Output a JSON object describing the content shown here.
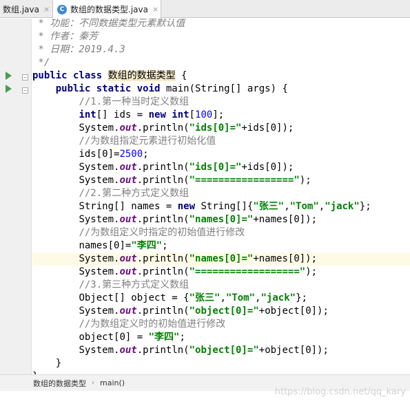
{
  "tabs": [
    {
      "label": "数组.java",
      "close": "×"
    },
    {
      "label": "数组的数据类型.java",
      "close": "×",
      "icon": "C"
    }
  ],
  "code": {
    "l01_comment": " * 功能：不同数据类型元素默认值",
    "l02_comment": " * 作者：秦芳",
    "l03_a": " * 日期：",
    "l03_b": "2019.4.3",
    "l04_comment": " */",
    "l05_kw": "public class",
    "l05_cls": "数组的数据类型",
    "l05_tail": " {",
    "l06_kw": "public static void",
    "l06_tail": " main(String[] args) {",
    "l07_comment": "//1.第一种当时定义数组",
    "l08_a": "int",
    "l08_b": "[] ids = ",
    "l08_c": "new int",
    "l08_d": "[",
    "l08_e": "100",
    "l08_f": "];",
    "sysout_a": "System.",
    "sysout_b": "out",
    "sysout_c": ".println(",
    "l09_str": "\"ids[0]=\"",
    "l09_tail": "+ids[0]);",
    "l10_comment": "//为数组指定元素进行初始化值",
    "l11_a": "ids[0]=",
    "l11_b": "2500",
    "l11_c": ";",
    "l12_str": "\"ids[0]=\"",
    "l12_tail": "+ids[0]);",
    "l13_str": "\"=================\"",
    "l13_tail": ");",
    "l14_comment": "//2.第二种方式定义数组",
    "l15_a": "String[] names = ",
    "l15_b": "new",
    "l15_c": " String[]{",
    "l15_s1": "\"张三\"",
    "l15_s2": "\"Tom\"",
    "l15_s3": "\"jack\"",
    "l15_end": "};",
    "l16_str": "\"names[0]=\"",
    "l16_tail": "+names[0]);",
    "l17_comment": "//为数组定义时指定的初始值进行修改",
    "l18_a": "names[0]=",
    "l18_str": "\"李四\"",
    "l18_c": ";",
    "l19_str": "\"names[0]=\"",
    "l19_tail": "+names[0]);",
    "l20_str": "\"==================\"",
    "l20_tail": ");",
    "l21_comment": "//3.第三种方式定义数组",
    "l22_a": "Object[] object = {",
    "l22_s1": "\"张三\"",
    "l22_s2": "\"Tom\"",
    "l22_s3": "\"jack\"",
    "l22_end": "};",
    "l23_str": "\"object[0]=\"",
    "l23_tail": "+object[0]);",
    "l24_comment": "//为数组定义时的初始值进行修改",
    "l25_a": "object[0] = ",
    "l25_str": "\"李四\"",
    "l25_c": ";",
    "l26_str": "\"object[0]=\"",
    "l26_tail": "+object[0]);",
    "l27_close": "}",
    "l28_close": "}",
    "comma": ","
  },
  "breadcrumb": {
    "class": "数组的数据类型",
    "method": "main()",
    "sep": "›"
  },
  "watermark": "https://blog.csdn.net/qq_kary"
}
